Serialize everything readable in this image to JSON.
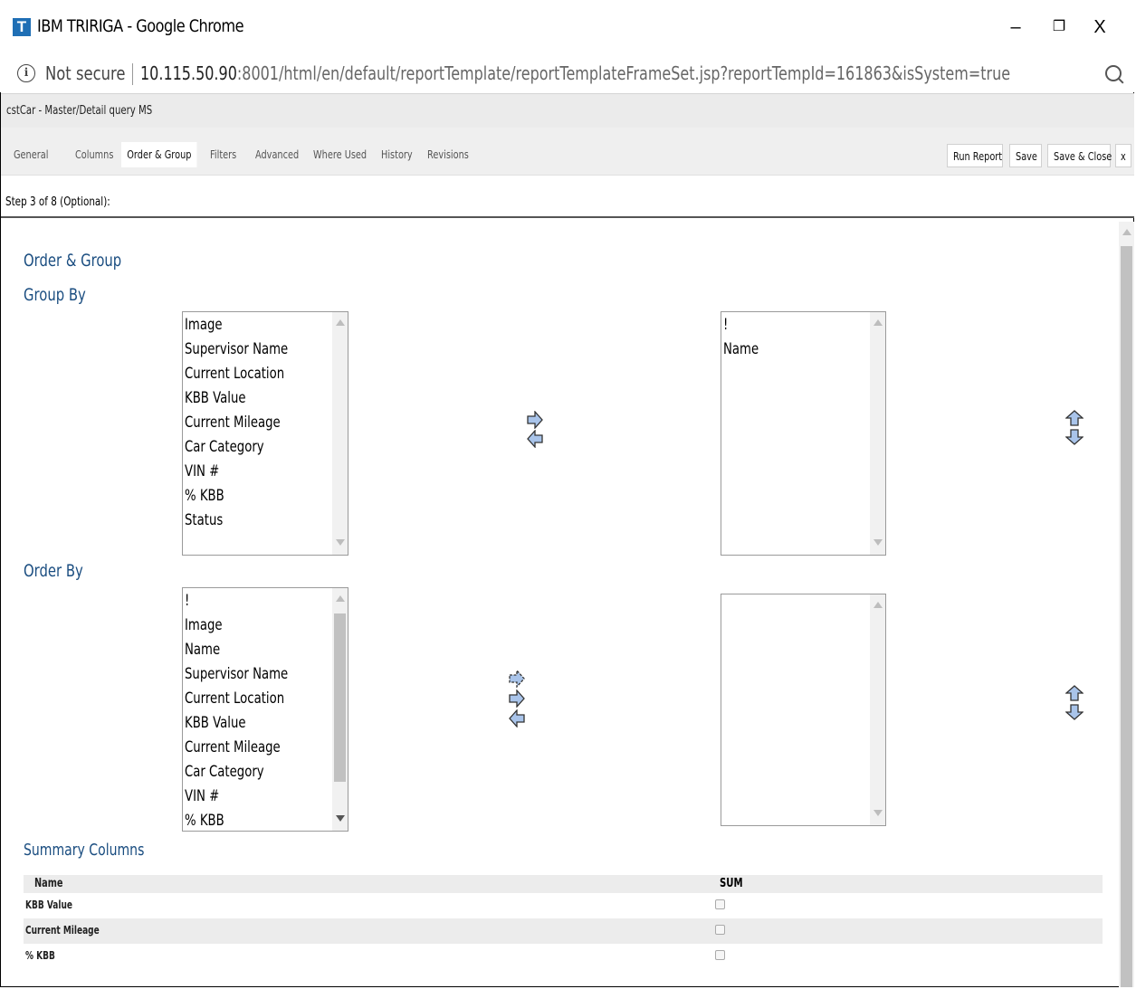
{
  "window": {
    "app_icon_letter": "T",
    "title": "IBM TRIRIGA - Google Chrome",
    "minimize_glyph": "–",
    "restore_glyph": "❐",
    "close_glyph": "X"
  },
  "address_bar": {
    "info_glyph": "i",
    "security_label": "Not secure",
    "url_host": "10.115.50.90",
    "url_rest": ":8001/html/en/default/reportTemplate/reportTemplateFrameSet.jsp?reportTempId=161863&isSystem=true"
  },
  "record_title": "cstCar - Master/Detail query MS",
  "tabs": [
    {
      "label": "General"
    },
    {
      "label": "Columns"
    },
    {
      "label": "Order & Group"
    },
    {
      "label": "Filters"
    },
    {
      "label": "Advanced"
    },
    {
      "label": "Where Used"
    },
    {
      "label": "History"
    },
    {
      "label": "Revisions"
    }
  ],
  "active_tab": "Order & Group",
  "actions": {
    "run_report": "Run Report",
    "save": "Save",
    "save_close": "Save & Close",
    "close": "x"
  },
  "step_text": "Step 3 of 8 (Optional):",
  "section_title": "Order & Group",
  "group_by": {
    "title": "Group By",
    "available": [
      "Image",
      "Supervisor Name",
      "Current Location",
      "KBB Value",
      "Current Mileage",
      "Car Category",
      "VIN #",
      "% KBB",
      "Status"
    ],
    "selected": [
      "!",
      "Name"
    ]
  },
  "order_by": {
    "title": "Order By",
    "available": [
      "!",
      "Image",
      "Name",
      "Supervisor Name",
      "Current Location",
      "KBB Value",
      "Current Mileage",
      "Car Category",
      "VIN #",
      "% KBB"
    ],
    "selected": []
  },
  "summary": {
    "title": "Summary Columns",
    "header_name": "Name",
    "header_sum": "SUM",
    "rows": [
      {
        "name": "KBB Value",
        "sum_checked": false
      },
      {
        "name": "Current Mileage",
        "sum_checked": false
      },
      {
        "name": "% KBB",
        "sum_checked": false
      }
    ]
  },
  "colors": {
    "heading": "#1a4d80",
    "arrow_fill": "#a9c4ea",
    "arrow_stroke": "#333333",
    "app_icon": "#1f6fb5"
  }
}
